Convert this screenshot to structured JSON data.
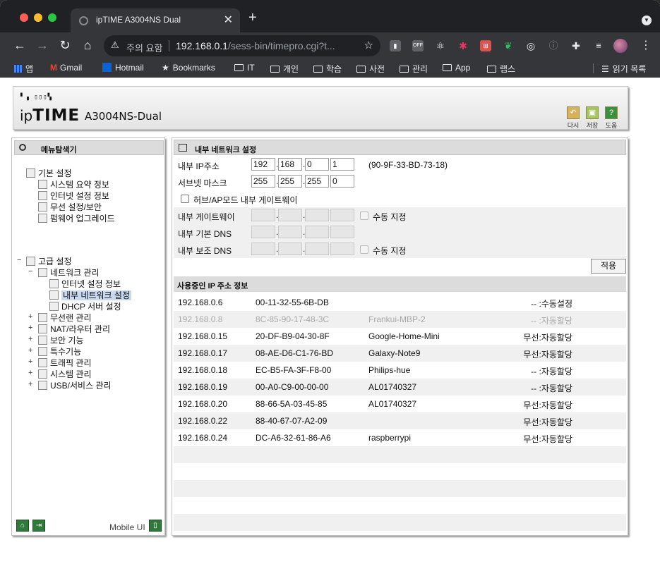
{
  "browser": {
    "tab_title": "ipTIME A3004NS Dual",
    "tab_close": "✕",
    "new_tab": "+",
    "security_status": "주의 요함",
    "url_host": "192.168.0.1",
    "url_path": "/sess-bin/timepro.cgi?t...",
    "bookmarks": [
      "앱",
      "Gmail",
      "Hotmail",
      "Bookmarks",
      "IT",
      "개인",
      "학습",
      "사전",
      "관리",
      "App",
      "랩스"
    ],
    "reading_list": "읽기 목록"
  },
  "header": {
    "logo_dots": "▘▗ ▯▯▯▚",
    "logo_prefix": "ip",
    "logo_bold": "TIME",
    "model": "A3004NS-Dual",
    "buttons": [
      {
        "label": "다시",
        "icon": "undo-icon"
      },
      {
        "label": "저장",
        "icon": "save-icon"
      },
      {
        "label": "도움",
        "icon": "help-icon"
      }
    ]
  },
  "sidebar": {
    "title": "메뉴탐색기",
    "basic": {
      "label": "기본 설정",
      "items": [
        "시스템 요약 정보",
        "인터넷 설정 정보",
        "무선 설정/보안",
        "펌웨어 업그레이드"
      ]
    },
    "advanced": {
      "label": "고급 설정",
      "network": {
        "label": "네트워크 관리",
        "items": [
          "인터넷 설정 정보",
          "내부 네트워크 설정",
          "DHCP 서버 설정"
        ],
        "selected_index": 1
      },
      "items": [
        "무선랜 관리",
        "NAT/라우터 관리",
        "보안 기능",
        "특수기능",
        "트래픽 관리",
        "시스템 관리",
        "USB/서비스 관리"
      ]
    },
    "mobile_ui": "Mobile UI"
  },
  "lan_settings": {
    "title": "내부 네트워크 설정",
    "ip_label": "내부 IP주소",
    "ip": [
      "192",
      "168",
      "0",
      "1"
    ],
    "mac_note": "(90-9F-33-BD-73-18)",
    "subnet_label": "서브넷 마스크",
    "subnet": [
      "255",
      "255",
      "255",
      "0"
    ],
    "hub_ap_label": "허브/AP모드 내부 게이트웨이",
    "gateway_label": "내부 게이트웨이",
    "manual_label": "수동 지정",
    "dns1_label": "내부 기본 DNS",
    "dns2_label": "내부 보조 DNS",
    "apply": "적용"
  },
  "ip_table": {
    "title": "사용중인 IP 주소 정보",
    "rows": [
      {
        "ip": "192.168.0.6",
        "mac": "00-11-32-55-6B-DB",
        "name": "",
        "type": "-- :수동설정",
        "dim": false
      },
      {
        "ip": "192.168.0.8",
        "mac": "8C-85-90-17-48-3C",
        "name": "Frankui-MBP-2",
        "type": "-- :자동할당",
        "dim": true
      },
      {
        "ip": "192.168.0.15",
        "mac": "20-DF-B9-04-30-8F",
        "name": "Google-Home-Mini",
        "type": "무선:자동할당",
        "dim": false
      },
      {
        "ip": "192.168.0.17",
        "mac": "08-AE-D6-C1-76-BD",
        "name": "Galaxy-Note9",
        "type": "무선:자동할당",
        "dim": false
      },
      {
        "ip": "192.168.0.18",
        "mac": "EC-B5-FA-3F-F8-00",
        "name": "Philips-hue",
        "type": "-- :자동할당",
        "dim": false
      },
      {
        "ip": "192.168.0.19",
        "mac": "00-A0-C9-00-00-00",
        "name": "AL01740327",
        "type": "-- :자동할당",
        "dim": false
      },
      {
        "ip": "192.168.0.20",
        "mac": "88-66-5A-03-45-85",
        "name": "AL01740327",
        "type": "무선:자동할당",
        "dim": false
      },
      {
        "ip": "192.168.0.22",
        "mac": "88-40-67-07-A2-09",
        "name": "",
        "type": "무선:자동할당",
        "dim": false
      },
      {
        "ip": "192.168.0.24",
        "mac": "DC-A6-32-61-86-A6",
        "name": "raspberrypi",
        "type": "무선:자동할당",
        "dim": false
      }
    ]
  }
}
